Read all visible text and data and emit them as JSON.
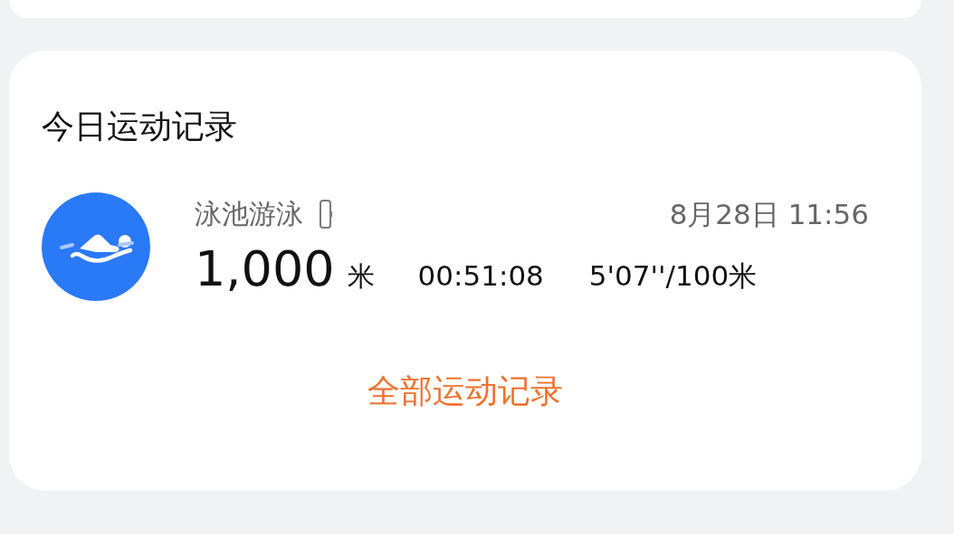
{
  "card": {
    "title": "今日运动记录",
    "records": [
      {
        "name": "泳池游泳",
        "date": "8月28日 11:56",
        "distance": "1,000",
        "distance_unit": "米",
        "duration": "00:51:08",
        "pace": "5'07''/100米"
      }
    ],
    "link": "全部运动记录"
  }
}
